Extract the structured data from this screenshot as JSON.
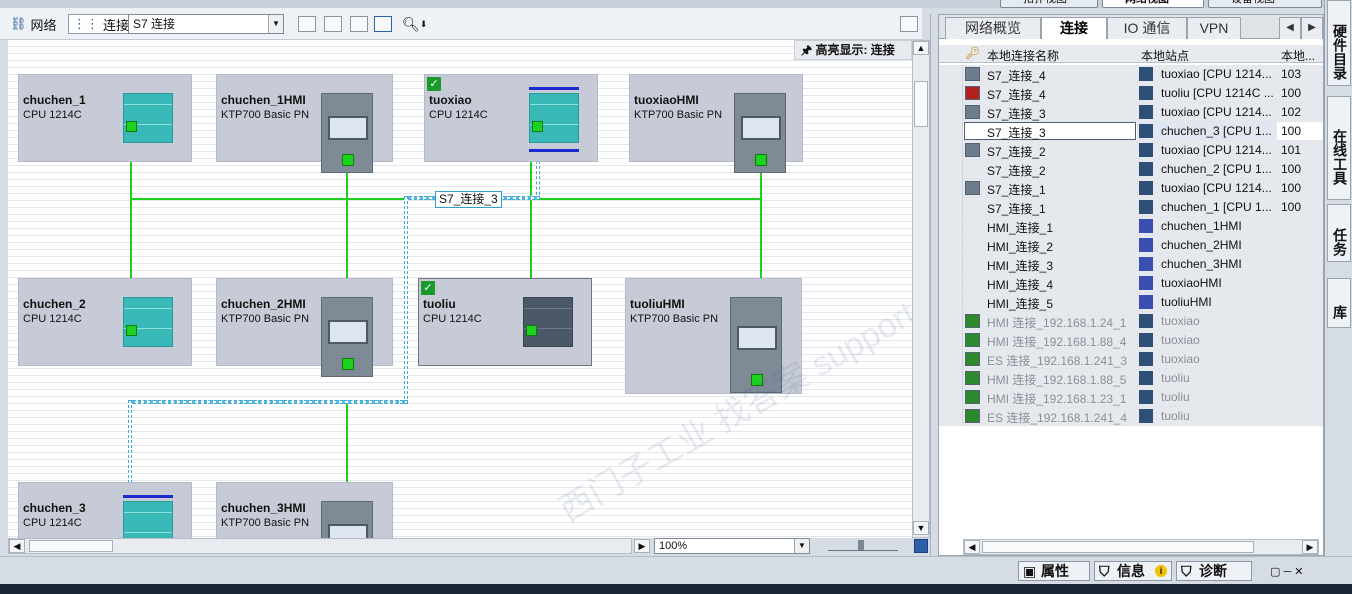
{
  "top_tabs": [
    "拓扑视图",
    "网络视图",
    "设备视图"
  ],
  "toolbar": {
    "network_label": "网络",
    "connections_label": "连接",
    "connection_type": "S7 连接"
  },
  "canvas": {
    "highlight_label": "高亮显示: 连接",
    "connection_label": "S7_连接_3",
    "devices": [
      {
        "name": "chuchen_1",
        "type": "CPU 1214C"
      },
      {
        "name": "chuchen_1HMI",
        "type": "KTP700 Basic PN"
      },
      {
        "name": "tuoxiao",
        "type": "CPU 1214C"
      },
      {
        "name": "tuoxiaoHMI",
        "type": "KTP700 Basic PN"
      },
      {
        "name": "chuchen_2",
        "type": "CPU 1214C"
      },
      {
        "name": "chuchen_2HMI",
        "type": "KTP700 Basic PN"
      },
      {
        "name": "tuoliu",
        "type": "CPU 1214C"
      },
      {
        "name": "tuoliuHMI",
        "type": "KTP700 Basic PN"
      },
      {
        "name": "chuchen_3",
        "type": "CPU 1214C"
      },
      {
        "name": "chuchen_3HMI",
        "type": "KTP700 Basic PN"
      }
    ],
    "zoom": "100%"
  },
  "right_panel": {
    "tabs": [
      "网络概览",
      "连接",
      "IO 通信",
      "VPN"
    ],
    "active_tab": "连接",
    "columns": [
      "本地连接名称",
      "本地站点",
      "本地..."
    ],
    "rows": [
      {
        "name": "S7_连接_4",
        "station": "tuoxiao [CPU 1214...",
        "id": "103"
      },
      {
        "name": "S7_连接_4",
        "station": "tuoliu [CPU 1214C ...",
        "id": "100"
      },
      {
        "name": "S7_连接_3",
        "station": "tuoxiao [CPU 1214...",
        "id": "102"
      },
      {
        "name": "S7_连接_3",
        "station": "chuchen_3 [CPU 1...",
        "id": "100"
      },
      {
        "name": "S7_连接_2",
        "station": "tuoxiao [CPU 1214...",
        "id": "101"
      },
      {
        "name": "S7_连接_2",
        "station": "chuchen_2 [CPU 1...",
        "id": "100"
      },
      {
        "name": "S7_连接_1",
        "station": "tuoxiao [CPU 1214...",
        "id": "100"
      },
      {
        "name": "S7_连接_1",
        "station": "chuchen_1 [CPU 1...",
        "id": "100"
      },
      {
        "name": "HMI_连接_1",
        "station": "chuchen_1HMI",
        "id": ""
      },
      {
        "name": "HMI_连接_2",
        "station": "chuchen_2HMI",
        "id": ""
      },
      {
        "name": "HMI_连接_3",
        "station": "chuchen_3HMI",
        "id": ""
      },
      {
        "name": "HMI_连接_4",
        "station": "tuoxiaoHMI",
        "id": ""
      },
      {
        "name": "HMI_连接_5",
        "station": "tuoliuHMI",
        "id": ""
      },
      {
        "name": "HMI 连接_192.168.1.24_1",
        "station": "tuoxiao",
        "id": ""
      },
      {
        "name": "HMI 连接_192.168.1.88_4",
        "station": "tuoxiao",
        "id": ""
      },
      {
        "name": "ES 连接_192.168.1.241_3",
        "station": "tuoxiao",
        "id": ""
      },
      {
        "name": "HMI 连接_192.168.1.88_5",
        "station": "tuoliu",
        "id": ""
      },
      {
        "name": "HMI 连接_192.168.1.23_1",
        "station": "tuoliu",
        "id": ""
      },
      {
        "name": "ES 连接_192.168.1.241_4",
        "station": "tuoliu",
        "id": ""
      }
    ]
  },
  "vertical_tabs": [
    "硬件目录",
    "在线工具",
    "任务",
    "库"
  ],
  "status_tabs": [
    "属性",
    "信息",
    "诊断"
  ],
  "watermark": "西门子工业 找答案 support.industry.siemens.com/cs"
}
